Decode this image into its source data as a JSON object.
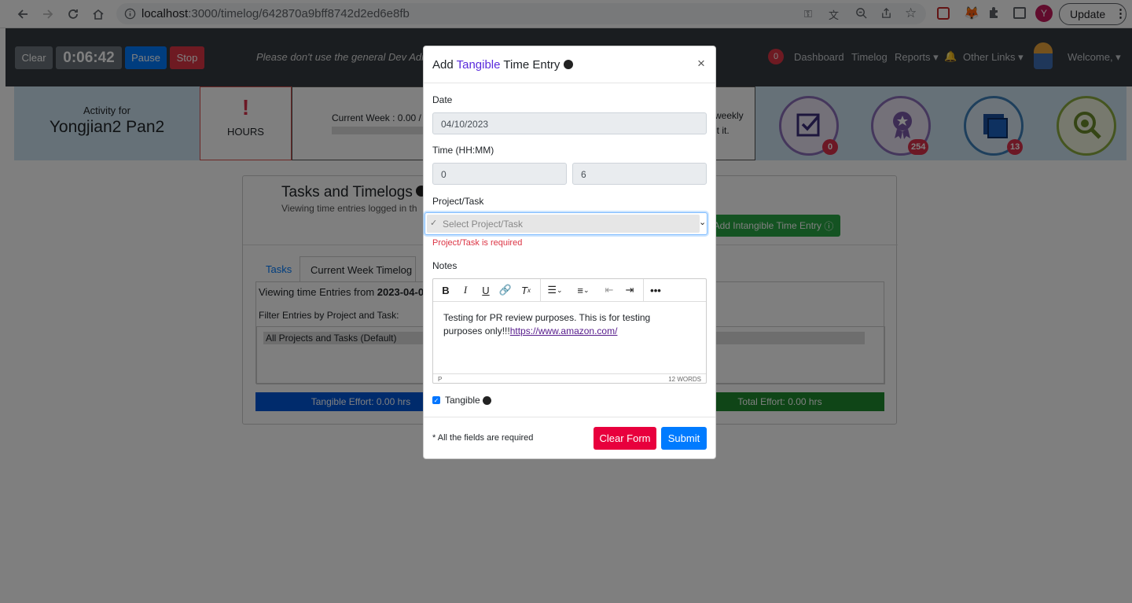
{
  "browser": {
    "url_host": "localhost",
    "url_path": ":3000/timelog/642870a9bff8742d2ed6e8fb",
    "update_label": "Update",
    "profile_initial": "Y"
  },
  "navbar": {
    "clear_label": "Clear",
    "timer": "0:06:42",
    "pause_label": "Pause",
    "stop_label": "Stop",
    "notice": "Please don't use the general Dev Admi",
    "notification_count": "0",
    "links": [
      "Dashboard",
      "Timelog",
      "Reports",
      "Other Links",
      "Welcome,"
    ]
  },
  "summary": {
    "activity_for": "Activity for",
    "user_name": "Yongjian2 Pan2",
    "hours_icon": "!",
    "hours_label": "HOURS",
    "current_week": "Current Week : 0.00 /",
    "weekly_text_1": "weekly",
    "weekly_text_2": "it it.",
    "badges": [
      {
        "name": "tasks",
        "count": "0"
      },
      {
        "name": "badges-earned",
        "count": "254"
      },
      {
        "name": "blue-square-record",
        "count": "13"
      },
      {
        "name": "report-app-bug",
        "count": ""
      }
    ]
  },
  "timelogs": {
    "title": "Tasks and Timelogs",
    "subtitle": "Viewing time entries logged in th",
    "add_intangible_label": "Add Intangible Time Entry",
    "tabs": [
      "Tasks",
      "Current Week Timelog"
    ],
    "viewing_prefix": "Viewing time Entries from",
    "viewing_date": "2023-04-0",
    "filter_label": "Filter Entries by Project and Task:",
    "filter_option": "All Projects and Tasks (Default)",
    "tangible_effort": "Tangible Effort: 0.00 hrs",
    "total_effort": "Total Effort: 0.00 hrs"
  },
  "modal": {
    "title_prefix": "Add",
    "title_highlight": "Tangible",
    "title_suffix": "Time Entry",
    "close": "×",
    "date_label": "Date",
    "date_value": "04/10/2023",
    "time_label": "Time (HH:MM)",
    "hours_value": "0",
    "minutes_value": "6",
    "project_label": "Project/Task",
    "project_placeholder": "Select Project/Task",
    "project_error": "Project/Task is required",
    "notes_label": "Notes",
    "notes_text": "Testing for PR review purposes. This is for testing purposes only!!!",
    "notes_link": "https://www.amazon.com/",
    "editor_path": "P",
    "word_count": "12 WORDS",
    "tangible_label": "Tangible",
    "tangible_checked": true,
    "required_note": "* All the fields are required",
    "clear_form_label": "Clear Form",
    "submit_label": "Submit"
  },
  "colors": {
    "accent_purple": "#5a2bdc",
    "danger": "#e8003d",
    "primary": "#007bff",
    "success": "#1e8a2e"
  }
}
